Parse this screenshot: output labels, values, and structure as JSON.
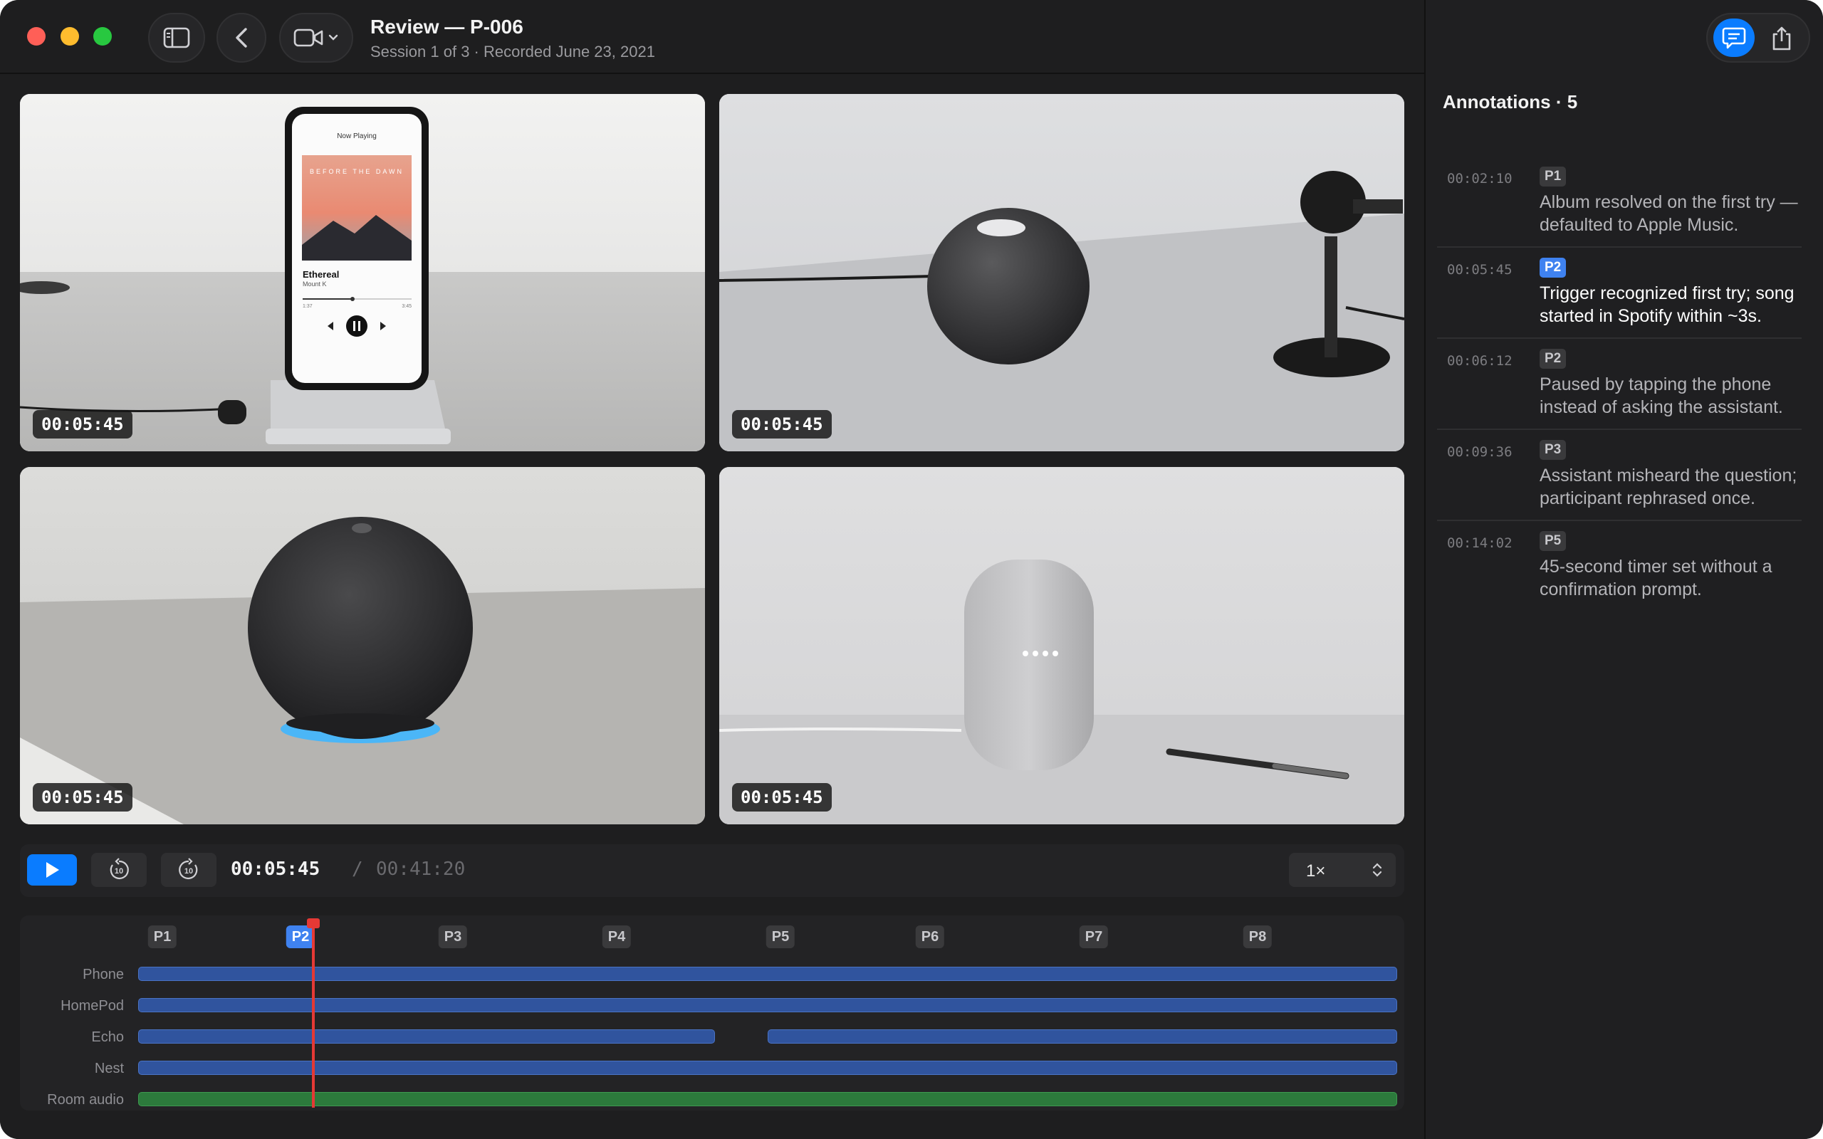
{
  "window": {
    "title": "Review — P-006",
    "subtitle": "Session 1 of 3 · Recorded June 23, 2021"
  },
  "videos": [
    {
      "name": "Phone",
      "timestamp": "00:05:45",
      "phone_screen": {
        "header": "Now Playing",
        "album_art_text": "BEFORE THE DAWN",
        "song": "Ethereal",
        "artist": "Mount K",
        "elapsed": "1:37",
        "duration": "3:45"
      }
    },
    {
      "name": "HomePod",
      "timestamp": "00:05:45"
    },
    {
      "name": "Echo",
      "timestamp": "00:05:45"
    },
    {
      "name": "Nest",
      "timestamp": "00:05:45"
    }
  ],
  "transport": {
    "current_time": "00:05:45",
    "separator": "/",
    "total_time": "00:41:20",
    "speed": "1×",
    "skip_back_seconds": "10",
    "skip_forward_seconds": "10"
  },
  "timeline": {
    "markers": [
      "P1",
      "P2",
      "P3",
      "P4",
      "P5",
      "P6",
      "P7",
      "P8"
    ],
    "active_marker": "P2",
    "tracks": [
      "Phone",
      "HomePod",
      "Echo",
      "Nest",
      "Room audio"
    ]
  },
  "sidebar": {
    "heading": "Annotations · 5",
    "annotations": [
      {
        "time": "00:02:10",
        "tag": "P1",
        "text": "Album resolved on the first try — defaulted to Apple Music.",
        "active": false
      },
      {
        "time": "00:05:45",
        "tag": "P2",
        "text": "Trigger recognized first try; song started in Spotify within ~3s.",
        "active": true
      },
      {
        "time": "00:06:12",
        "tag": "P2",
        "text": "Paused by tapping the phone instead of asking the assistant.",
        "active": false
      },
      {
        "time": "00:09:36",
        "tag": "P3",
        "text": "Assistant misheard the question; participant rephrased once.",
        "active": false
      },
      {
        "time": "00:14:02",
        "tag": "P5",
        "text": "45-second timer set without a confirmation prompt.",
        "active": false
      }
    ]
  },
  "colors": {
    "accent": "#0a7cff",
    "marker_active": "#3f82f0",
    "track_blue": "#30549e",
    "track_green": "#2c7a3c",
    "playhead": "#e53935"
  },
  "icons": [
    "sidebar-toggle-icon",
    "chevron-left-icon",
    "video-camera-icon",
    "chevron-down-icon",
    "play-icon",
    "skip-back-icon",
    "skip-forward-icon",
    "stepper-icon",
    "comment-icon",
    "share-icon"
  ]
}
